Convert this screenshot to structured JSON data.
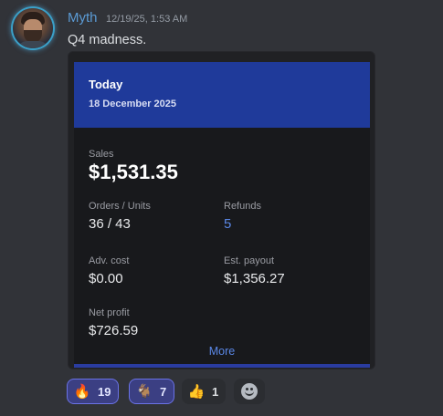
{
  "message": {
    "username": "Myth",
    "timestamp": "12/19/25, 1:53 AM",
    "text": "Q4 madness."
  },
  "embed": {
    "title": "Today",
    "date": "18 December 2025",
    "sales_label": "Sales",
    "sales_value": "$1,531.35",
    "orders_label": "Orders / Units",
    "orders_value": "36 / 43",
    "refunds_label": "Refunds",
    "refunds_value": "5",
    "adv_cost_label": "Adv. cost",
    "adv_cost_value": "$0.00",
    "payout_label": "Est. payout",
    "payout_value": "$1,356.27",
    "profit_label": "Net profit",
    "profit_value": "$726.59",
    "more_label": "More",
    "accent_color": "#1f3a9a",
    "link_color": "#5a87e6"
  },
  "reactions": [
    {
      "icon": "fire-emoji",
      "glyph": "🔥",
      "count": "19",
      "active": true
    },
    {
      "icon": "goat-emoji",
      "glyph": "🐐",
      "count": "7",
      "active": true
    },
    {
      "icon": "thumbs-up-emoji",
      "glyph": "👍",
      "count": "1",
      "active": false
    }
  ],
  "add_reaction_icon": "add-reaction-icon"
}
